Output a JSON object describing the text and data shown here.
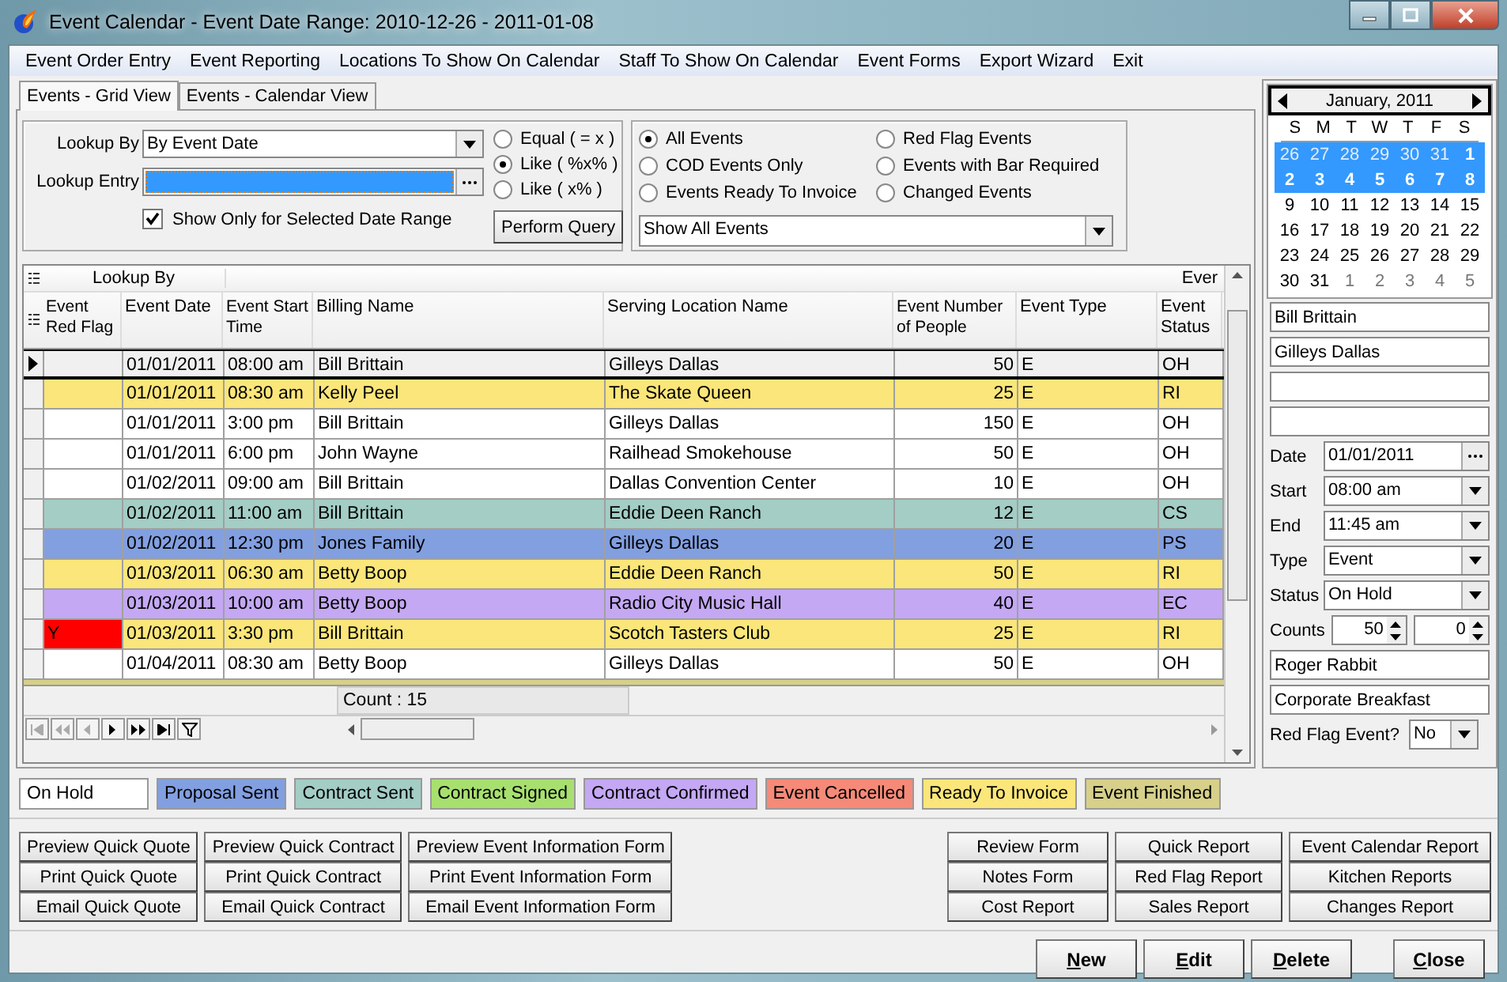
{
  "window": {
    "title": "Event Calendar - Event Date Range: 2010-12-26 - 2011-01-08"
  },
  "menu": [
    "Event Order Entry",
    "Event Reporting",
    "Locations To Show On Calendar",
    "Staff To Show On Calendar",
    "Event Forms",
    "Export Wizard",
    "Exit"
  ],
  "tabs": [
    {
      "label": "Events - Grid View",
      "selected": true
    },
    {
      "label": "Events - Calendar View",
      "selected": false
    }
  ],
  "query": {
    "lookup_by_label": "Lookup By",
    "lookup_by": "By Event Date",
    "lookup_entry_label": "Lookup Entry",
    "match_options": [
      {
        "label": "Equal ( = x )",
        "selected": false
      },
      {
        "label": "Like ( %x% )",
        "selected": true
      },
      {
        "label": "Like ( x% )",
        "selected": false
      }
    ],
    "show_only_range": {
      "label": "Show Only for Selected Date Range",
      "checked": true
    },
    "perform_button": "Perform Query"
  },
  "filters": [
    {
      "label": "All Events",
      "selected": true
    },
    {
      "label": "COD Events Only",
      "selected": false
    },
    {
      "label": "Events Ready To Invoice",
      "selected": false
    },
    {
      "label": "Red Flag Events",
      "selected": false
    },
    {
      "label": "Events with Bar Required",
      "selected": false
    },
    {
      "label": "Changed Events",
      "selected": false
    }
  ],
  "filter_dropdown": "Show All Events",
  "grid": {
    "group_headers": [
      "Lookup By",
      "Ever"
    ],
    "columns": [
      {
        "label": "Event Red Flag",
        "kind": "flag"
      },
      {
        "label": "Event Date",
        "kind": "text"
      },
      {
        "label": "Event Start Time",
        "kind": "text"
      },
      {
        "label": "Billing Name",
        "kind": "text"
      },
      {
        "label": "Serving Location Name",
        "kind": "text"
      },
      {
        "label": "Event Number of People",
        "kind": "number"
      },
      {
        "label": "Event Type",
        "kind": "text"
      },
      {
        "label": "Event Status",
        "kind": "text"
      }
    ],
    "rows": [
      {
        "selected": true,
        "color": "#f0f0f0",
        "red_flag": false,
        "cells": [
          "",
          "01/01/2011",
          "08:00 am",
          "Bill Brittain",
          "Gilleys Dallas",
          "50",
          "E",
          "OH"
        ]
      },
      {
        "selected": false,
        "color": "#fae67a",
        "red_flag": false,
        "cells": [
          "",
          "01/01/2011",
          "08:30 am",
          "Kelly Peel",
          "The Skate Queen",
          "25",
          "E",
          "RI"
        ]
      },
      {
        "selected": false,
        "color": "#ffffff",
        "red_flag": false,
        "cells": [
          "",
          "01/01/2011",
          "3:00 pm",
          "Bill Brittain",
          "Gilleys Dallas",
          "150",
          "E",
          "OH"
        ]
      },
      {
        "selected": false,
        "color": "#ffffff",
        "red_flag": false,
        "cells": [
          "",
          "01/01/2011",
          "6:00 pm",
          "John Wayne",
          "Railhead Smokehouse",
          "50",
          "E",
          "OH"
        ]
      },
      {
        "selected": false,
        "color": "#ffffff",
        "red_flag": false,
        "cells": [
          "",
          "01/02/2011",
          "09:00 am",
          "Bill Brittain",
          "Dallas Convention Center",
          "10",
          "E",
          "OH"
        ]
      },
      {
        "selected": false,
        "color": "#a3cdc5",
        "red_flag": false,
        "cells": [
          "",
          "01/02/2011",
          "11:00 am",
          "Bill Brittain",
          "Eddie Deen Ranch",
          "12",
          "E",
          "CS"
        ]
      },
      {
        "selected": false,
        "color": "#829fe0",
        "red_flag": false,
        "cells": [
          "",
          "01/02/2011",
          "12:30 pm",
          "Jones Family",
          "Gilleys Dallas",
          "20",
          "E",
          "PS"
        ]
      },
      {
        "selected": false,
        "color": "#fae67a",
        "red_flag": false,
        "cells": [
          "",
          "01/03/2011",
          "06:30 am",
          "Betty Boop",
          "Eddie Deen Ranch",
          "50",
          "E",
          "RI"
        ]
      },
      {
        "selected": false,
        "color": "#c4a8f3",
        "red_flag": false,
        "cells": [
          "",
          "01/03/2011",
          "10:00 am",
          "Betty Boop",
          "Radio City Music Hall",
          "40",
          "E",
          "EC"
        ]
      },
      {
        "selected": false,
        "color": "#fae67a",
        "red_flag": true,
        "cells": [
          "Y",
          "01/03/2011",
          "3:30 pm",
          "Bill Brittain",
          "Scotch Tasters Club",
          "25",
          "E",
          "RI"
        ]
      },
      {
        "selected": false,
        "color": "#ffffff",
        "red_flag": false,
        "cells": [
          "",
          "01/04/2011",
          "08:30 am",
          "Betty Boop",
          "Gilleys Dallas",
          "50",
          "E",
          "OH"
        ]
      }
    ],
    "count": "Count : 15"
  },
  "calendar": {
    "month": "January, 2011",
    "weekdays": [
      "S",
      "M",
      "T",
      "W",
      "T",
      "F",
      "S"
    ],
    "weeks": [
      [
        {
          "d": "26",
          "other_month": true,
          "selected": true
        },
        {
          "d": "27",
          "other_month": true,
          "selected": true
        },
        {
          "d": "28",
          "other_month": true,
          "selected": true
        },
        {
          "d": "29",
          "other_month": true,
          "selected": true
        },
        {
          "d": "30",
          "other_month": true,
          "selected": true
        },
        {
          "d": "31",
          "other_month": true,
          "selected": true
        },
        {
          "d": "1",
          "other_month": false,
          "selected": true
        }
      ],
      [
        {
          "d": "2",
          "other_month": false,
          "selected": true
        },
        {
          "d": "3",
          "other_month": false,
          "selected": true
        },
        {
          "d": "4",
          "other_month": false,
          "selected": true
        },
        {
          "d": "5",
          "other_month": false,
          "selected": true
        },
        {
          "d": "6",
          "other_month": false,
          "selected": true
        },
        {
          "d": "7",
          "other_month": false,
          "selected": true
        },
        {
          "d": "8",
          "other_month": false,
          "selected": true
        }
      ],
      [
        {
          "d": "9",
          "other_month": false,
          "selected": false
        },
        {
          "d": "10",
          "other_month": false,
          "selected": false
        },
        {
          "d": "11",
          "other_month": false,
          "selected": false
        },
        {
          "d": "12",
          "other_month": false,
          "selected": false
        },
        {
          "d": "13",
          "other_month": false,
          "selected": false
        },
        {
          "d": "14",
          "other_month": false,
          "selected": false
        },
        {
          "d": "15",
          "other_month": false,
          "selected": false
        }
      ],
      [
        {
          "d": "16",
          "other_month": false,
          "selected": false
        },
        {
          "d": "17",
          "other_month": false,
          "selected": false
        },
        {
          "d": "18",
          "other_month": false,
          "selected": false
        },
        {
          "d": "19",
          "other_month": false,
          "selected": false
        },
        {
          "d": "20",
          "other_month": false,
          "selected": false
        },
        {
          "d": "21",
          "other_month": false,
          "selected": false
        },
        {
          "d": "22",
          "other_month": false,
          "selected": false
        }
      ],
      [
        {
          "d": "23",
          "other_month": false,
          "selected": false
        },
        {
          "d": "24",
          "other_month": false,
          "selected": false
        },
        {
          "d": "25",
          "other_month": false,
          "selected": false
        },
        {
          "d": "26",
          "other_month": false,
          "selected": false
        },
        {
          "d": "27",
          "other_month": false,
          "selected": false
        },
        {
          "d": "28",
          "other_month": false,
          "selected": false
        },
        {
          "d": "29",
          "other_month": false,
          "selected": false
        }
      ],
      [
        {
          "d": "30",
          "other_month": false,
          "selected": false
        },
        {
          "d": "31",
          "other_month": false,
          "selected": false
        },
        {
          "d": "1",
          "other_month": true,
          "selected": false
        },
        {
          "d": "2",
          "other_month": true,
          "selected": false
        },
        {
          "d": "3",
          "other_month": true,
          "selected": false
        },
        {
          "d": "4",
          "other_month": true,
          "selected": false
        },
        {
          "d": "5",
          "other_month": true,
          "selected": false
        }
      ]
    ]
  },
  "details": {
    "billing_name": "Bill Brittain",
    "location": "Gilleys Dallas",
    "date_label": "Date",
    "date": "01/01/2011",
    "start_label": "Start",
    "start": "08:00 am",
    "end_label": "End",
    "end": "11:45 am",
    "type_label": "Type",
    "type": "Event",
    "status_label": "Status",
    "status": "On Hold",
    "counts_label": "Counts",
    "count_1": "50",
    "count_2": "0",
    "contact": "Roger Rabbit",
    "event_name": "Corporate Breakfast",
    "red_flag_label": "Red Flag Event?",
    "red_flag": "No"
  },
  "legend": [
    {
      "label": "On Hold",
      "color": "#ffffff"
    },
    {
      "label": "Proposal Sent",
      "color": "#829fe0"
    },
    {
      "label": "Contract Sent",
      "color": "#a3cdc5"
    },
    {
      "label": "Contract Signed",
      "color": "#a8e070"
    },
    {
      "label": "Contract Confirmed",
      "color": "#c4a8f3"
    },
    {
      "label": "Event Cancelled",
      "color": "#f58a78"
    },
    {
      "label": "Ready To Invoice",
      "color": "#fae67a"
    },
    {
      "label": "Event Finished",
      "color": "#d6d08a"
    }
  ],
  "form_buttons": [
    [
      "Preview Quick Quote",
      "Print Quick Quote",
      "Email Quick Quote"
    ],
    [
      "Preview Quick Contract",
      "Print Quick Contract",
      "Email Quick Contract"
    ],
    [
      "Preview Event Information Form",
      "Print Event Information Form",
      "Email Event Information Form"
    ]
  ],
  "report_buttons": [
    [
      "Review Form",
      "Notes Form",
      "Cost Report"
    ],
    [
      "Quick Report",
      "Red Flag Report",
      "Sales Report"
    ],
    [
      "Event Calendar Report",
      "Kitchen Reports",
      "Changes Report"
    ]
  ],
  "action_buttons": [
    "New",
    "Edit",
    "Delete"
  ],
  "close_button": "Close"
}
